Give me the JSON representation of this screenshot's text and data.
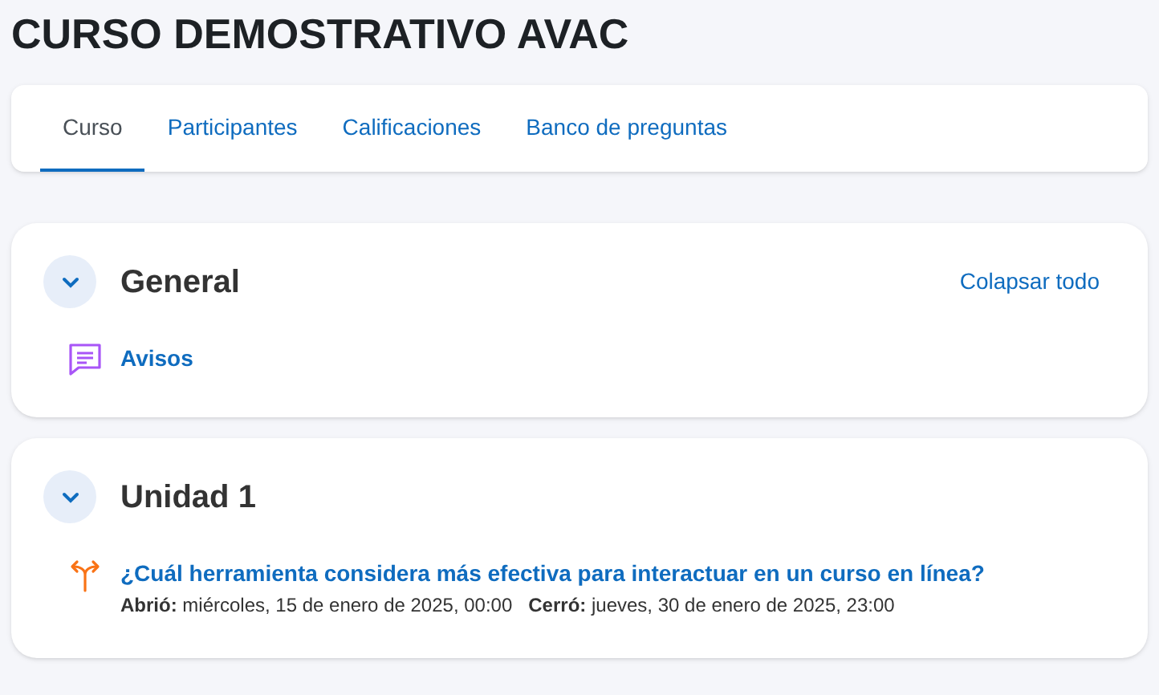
{
  "page_title": "CURSO DEMOSTRATIVO AVAC",
  "tabs": [
    {
      "label": "Curso",
      "selected": true
    },
    {
      "label": "Participantes",
      "selected": false
    },
    {
      "label": "Calificaciones",
      "selected": false
    },
    {
      "label": "Banco de preguntas",
      "selected": false
    }
  ],
  "collapse_all": "Colapsar todo",
  "sections": [
    {
      "title": "General",
      "expanded": true,
      "activities": [
        {
          "kind": "forum",
          "name": "Avisos"
        }
      ]
    },
    {
      "title": "Unidad 1",
      "expanded": true,
      "activities": [
        {
          "kind": "choice",
          "name": "¿Cuál herramienta considera más efectiva para interactuar en un curso en línea?",
          "dates": [
            "**Abrió:** miércoles, 15 de enero de 2025, 00:00",
            "**Cerró:** jueves, 30 de enero de 2025, 23:00"
          ]
        }
      ]
    }
  ]
}
